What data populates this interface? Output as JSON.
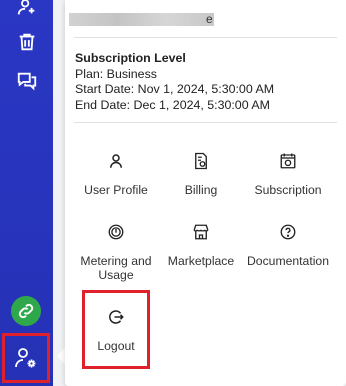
{
  "sidebar": {
    "icons": [
      "user-add-icon",
      "trash-icon",
      "chat-icon",
      "link-icon",
      "user-settings-icon"
    ]
  },
  "popup": {
    "email_tail": "e",
    "subscription": {
      "title": "Subscription Level",
      "plan": "Plan: Business",
      "start": "Start Date: Nov 1, 2024, 5:30:00 AM",
      "end": "End Date: Dec 1, 2024, 5:30:00 AM"
    },
    "tiles": {
      "user_profile": "User Profile",
      "billing": "Billing",
      "subscription": "Subscription",
      "metering": "Metering and Usage",
      "marketplace": "Marketplace",
      "documentation": "Documentation",
      "logout": "Logout"
    }
  },
  "colors": {
    "sidebar": "#2a37c4",
    "highlight": "#e0202a",
    "link_green": "#2ea84a"
  }
}
